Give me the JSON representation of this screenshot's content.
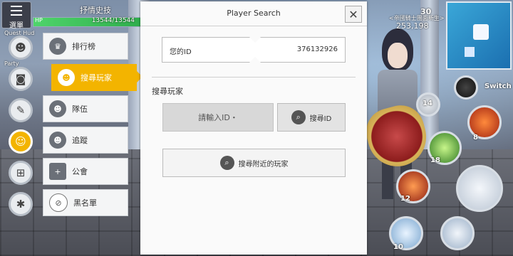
{
  "hud": {
    "menu_label": "選單",
    "player_name": "抒情史技",
    "hp_label": "HP",
    "hp_text": "13544/13544",
    "hp_fraction": 1.0,
    "guest_label": "Quest Hud",
    "party_label": "Party",
    "right_score": "30",
    "right_value": "253,198",
    "right_guild": "<帝國騎士團面新生>",
    "switch_label": "Switch"
  },
  "side_icons": [
    {
      "name": "profile",
      "glyph": "☻"
    },
    {
      "name": "bag",
      "glyph": "◙"
    },
    {
      "name": "quest",
      "glyph": "✎"
    },
    {
      "name": "social",
      "glyph": "☺"
    },
    {
      "name": "shop",
      "glyph": "⊞"
    },
    {
      "name": "settings",
      "glyph": "✱"
    }
  ],
  "submenu": [
    {
      "label": "排行榜",
      "glyph": "♛"
    },
    {
      "label": "搜尋玩家",
      "glyph": "☻"
    },
    {
      "label": "隊伍",
      "glyph": "☻"
    },
    {
      "label": "追蹤",
      "glyph": "☻"
    },
    {
      "label": "公會",
      "glyph": "+"
    },
    {
      "label": "黑名單",
      "glyph": "⊘"
    }
  ],
  "panel": {
    "title": "Player Search",
    "close_glyph": "✕",
    "your_id_label": "您的ID",
    "your_id_value": "376132926",
    "section_title": "搜尋玩家",
    "id_input_placeholder": "請輸入ID・",
    "search_id_label": "搜尋ID",
    "search_nearby_label": "搜尋附近的玩家",
    "search_glyph": "⌕"
  },
  "skills": [
    {
      "name": "skill-1",
      "count": "14"
    },
    {
      "name": "skill-2",
      "count": "8"
    },
    {
      "name": "skill-3",
      "count": "18"
    },
    {
      "name": "skill-4",
      "count": "12"
    },
    {
      "name": "skill-5",
      "count": "10"
    }
  ],
  "colors": {
    "accent": "#f3b400",
    "hp": "#4fd46b"
  }
}
